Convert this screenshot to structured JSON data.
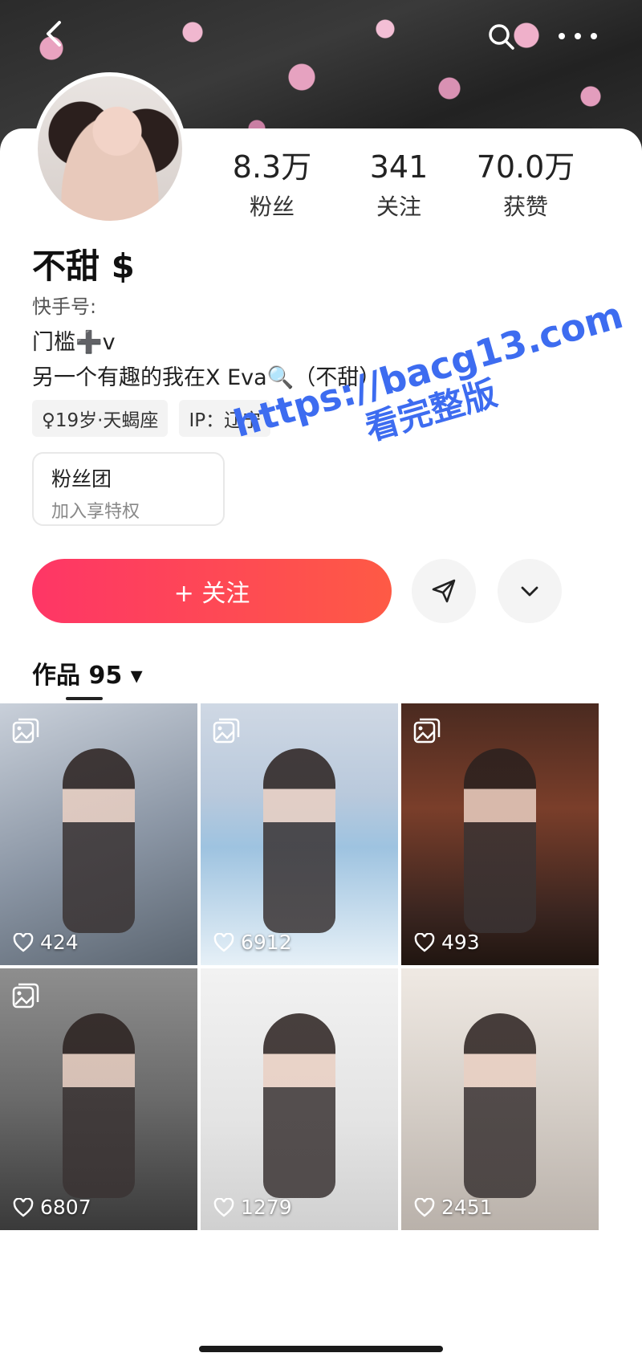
{
  "header": {
    "back_icon": "chevron-left-icon",
    "search_icon": "search-icon",
    "more_icon": "more-dots-icon"
  },
  "profile": {
    "stats": [
      {
        "value": "8.3万",
        "label": "粉丝"
      },
      {
        "value": "341",
        "label": "关注"
      },
      {
        "value": "70.0万",
        "label": "获赞"
      }
    ],
    "name": "不甜 $",
    "kuaishou_id_label": "快手号:",
    "bio_line1": "门槛➕v",
    "bio_line2": "另一个有趣的我在X Eva🔍（不甜）",
    "tags": [
      "♀19岁·天蝎座",
      "IP：辽宁"
    ],
    "fan_club": {
      "title": "粉丝团",
      "subtitle": "加入享特权"
    }
  },
  "actions": {
    "follow_label": "+ 关注",
    "share_icon": "send-icon",
    "expand_icon": "chevron-down-icon"
  },
  "tabs": {
    "works_label": "作品 95 ▾"
  },
  "posts": [
    {
      "likes": "424",
      "gallery": true
    },
    {
      "likes": "6912",
      "gallery": true
    },
    {
      "likes": "493",
      "gallery": true
    },
    {
      "likes": "6807",
      "gallery": true
    },
    {
      "likes": "1279",
      "gallery": false
    },
    {
      "likes": "2451",
      "gallery": false
    }
  ],
  "watermark": {
    "line1": "https://bacg13.com",
    "line2": "看完整版",
    "color": "#3d6cf0"
  },
  "colors": {
    "follow_start": "#fe3666",
    "follow_end": "#fe5a45"
  }
}
